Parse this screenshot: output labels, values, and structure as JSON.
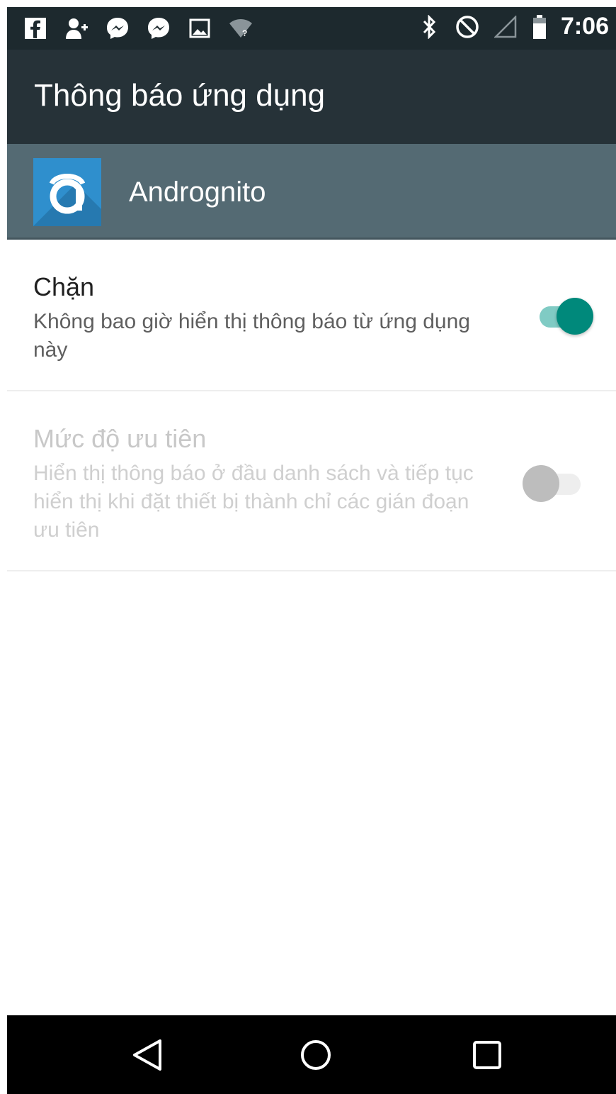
{
  "status_bar": {
    "time": "7:06",
    "left_icons": [
      "facebook-icon",
      "contact-add-icon",
      "messenger-icon",
      "messenger-icon",
      "image-icon",
      "wifi-question-icon"
    ],
    "right_icons": [
      "bluetooth-icon",
      "do-not-disturb-icon",
      "signal-icon",
      "battery-icon"
    ]
  },
  "toolbar": {
    "title": "Thông báo ứng dụng"
  },
  "app": {
    "name": "Andrognito",
    "icon": "andrognito-app-icon",
    "icon_color": "#2f8fcd"
  },
  "preferences": [
    {
      "title": "Chặn",
      "summary": "Không bao giờ hiển thị thông báo từ ứng dụng này",
      "enabled": true,
      "checked": true
    },
    {
      "title": "Mức độ ưu tiên",
      "summary": "Hiển thị thông báo ở đầu danh sách và tiếp tục hiển thị khi đặt thiết bị thành chỉ các gián đoạn ưu tiên",
      "enabled": false,
      "checked": false
    }
  ],
  "colors": {
    "status_bar": "#1d292e",
    "toolbar": "#263238",
    "app_header": "#546a73",
    "switch_on_thumb": "#00897b",
    "switch_on_track": "#80cbc4",
    "switch_off_thumb": "#bdbdbd",
    "switch_off_track": "#eeeeee"
  },
  "nav_bar": {
    "buttons": [
      "back-icon",
      "home-icon",
      "recents-icon"
    ]
  }
}
